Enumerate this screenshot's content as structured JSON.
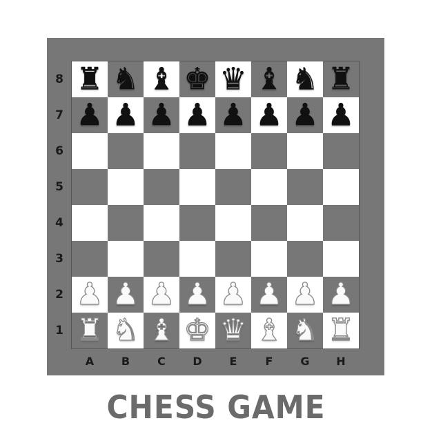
{
  "title": "CHESS GAME",
  "colors": {
    "frame": "#777777",
    "light_square": "#ffffff",
    "dark_square": "#777777",
    "title_text": "#6b6b6b"
  },
  "board": {
    "files": [
      "A",
      "B",
      "C",
      "D",
      "E",
      "F",
      "G",
      "H"
    ],
    "ranks": [
      "8",
      "7",
      "6",
      "5",
      "4",
      "3",
      "2",
      "1"
    ],
    "top_left_square_color": "light",
    "position": [
      [
        "black-rook",
        "black-knight",
        "black-bishop",
        "black-king",
        "black-queen",
        "black-bishop",
        "black-knight",
        "black-rook"
      ],
      [
        "black-pawn",
        "black-pawn",
        "black-pawn",
        "black-pawn",
        "black-pawn",
        "black-pawn",
        "black-pawn",
        "black-pawn"
      ],
      [
        "",
        "",
        "",
        "",
        "",
        "",
        "",
        ""
      ],
      [
        "",
        "",
        "",
        "",
        "",
        "",
        "",
        ""
      ],
      [
        "",
        "",
        "",
        "",
        "",
        "",
        "",
        ""
      ],
      [
        "",
        "",
        "",
        "",
        "",
        "",
        "",
        ""
      ],
      [
        "white-pawn",
        "white-pawn",
        "white-pawn",
        "white-pawn",
        "white-pawn",
        "white-pawn",
        "white-pawn",
        "white-pawn"
      ],
      [
        "white-rook",
        "white-knight",
        "white-bishop",
        "white-king",
        "white-queen",
        "white-bishop",
        "white-knight",
        "white-rook"
      ]
    ]
  }
}
